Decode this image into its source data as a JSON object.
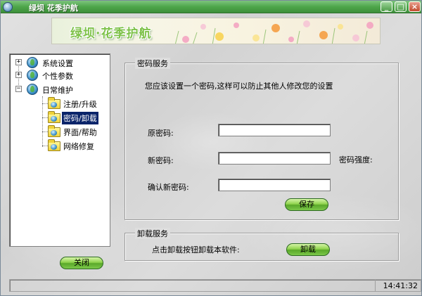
{
  "window": {
    "title": "绿坝 花季护航",
    "icon": "app-globe-icon",
    "controls": {
      "minimize": "_",
      "maximize": "□",
      "close": "×"
    },
    "colors": {
      "titlebar": "#4ea64a",
      "selection": "#0a246a",
      "button_green": "#8fd34d"
    }
  },
  "banner": {
    "title": "绿坝·花季护航"
  },
  "tree": {
    "items": [
      {
        "label": "系统设置",
        "icon": "globe-icon",
        "expander": "+"
      },
      {
        "label": "个性参数",
        "icon": "globe-icon",
        "expander": "+"
      },
      {
        "label": "日常维护",
        "icon": "globe-icon",
        "expander": "−"
      },
      {
        "label": "注册/升级",
        "icon": "folder-icon"
      },
      {
        "label": "密码/卸载",
        "icon": "folder-icon",
        "selected": true
      },
      {
        "label": "界面/帮助",
        "icon": "folder-icon"
      },
      {
        "label": "网络修复",
        "icon": "folder-icon"
      }
    ]
  },
  "password_service": {
    "title": "密码服务",
    "description": "您应该设置一个密码,这样可以防止其他人修改您的设置",
    "old_password_label": "原密码:",
    "old_password_value": "",
    "new_password_label": "新密码:",
    "new_password_value": "",
    "strength_label": "密码强度:",
    "confirm_label": "确认新密码:",
    "confirm_value": "",
    "save_button": "保存"
  },
  "uninstall_service": {
    "title": "卸载服务",
    "description": "点击卸载按钮卸载本软件:",
    "uninstall_button": "卸载"
  },
  "close_button": "关闭",
  "statusbar": {
    "time": "14:41:32"
  }
}
